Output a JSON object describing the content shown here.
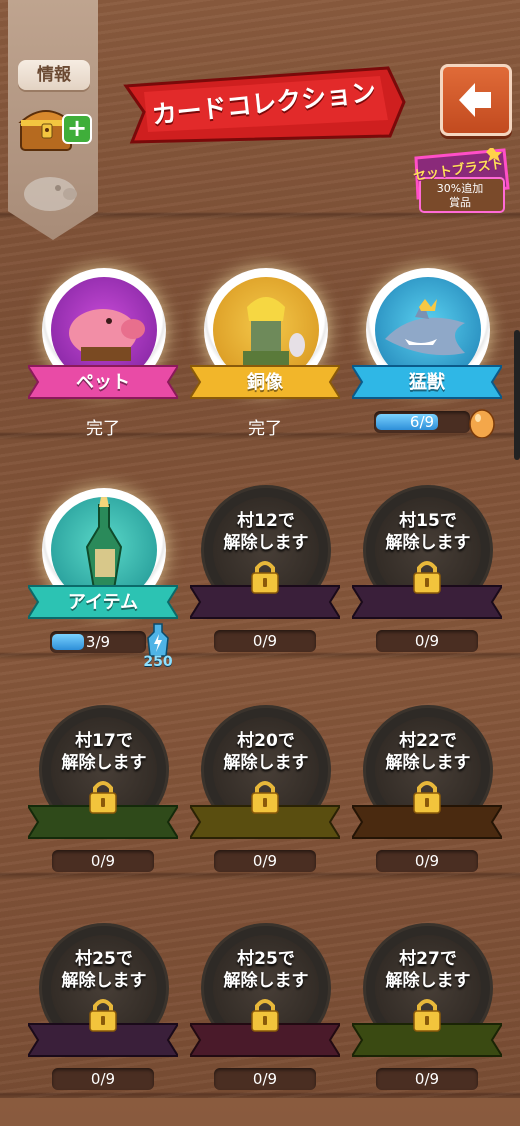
{
  "sidebar": {
    "info_label": "情報"
  },
  "header": {
    "title": "カードコレクション",
    "set_blast": {
      "title": "セットブラスト",
      "line1": "30%追加",
      "line2": "賞品"
    }
  },
  "cards": [
    {
      "banner": "ペット",
      "status": "完了",
      "banner_color": "#e94ba6"
    },
    {
      "banner": "銅像",
      "status": "完了",
      "banner_color": "#f2b62a"
    },
    {
      "banner": "猛獣",
      "banner_color": "#2fb7e6",
      "progress_text": "6/9",
      "progress": 0.67
    },
    {
      "banner": "アイテム",
      "banner_color": "#2cc3b3",
      "progress_text": "3/9",
      "progress": 0.33,
      "reward": "250"
    },
    {
      "lock_line1": "村12で",
      "lock_line2": "解除します",
      "count": "0/9",
      "banner_color": "#3a1f3a"
    },
    {
      "lock_line1": "村15で",
      "lock_line2": "解除します",
      "count": "0/9",
      "banner_color": "#3a1f3a"
    },
    {
      "lock_line1": "村17で",
      "lock_line2": "解除します",
      "count": "0/9",
      "banner_color": "#2f4a1a"
    },
    {
      "lock_line1": "村20で",
      "lock_line2": "解除します",
      "count": "0/9",
      "banner_color": "#5a4e10"
    },
    {
      "lock_line1": "村22で",
      "lock_line2": "解除します",
      "count": "0/9",
      "banner_color": "#4a2a10"
    },
    {
      "lock_line1": "村25で",
      "lock_line2": "解除します",
      "count": "0/9",
      "banner_color": "#3a1f3a"
    },
    {
      "lock_line1": "村25で",
      "lock_line2": "解除します",
      "count": "0/9",
      "banner_color": "#4a1a2a"
    },
    {
      "lock_line1": "村27で",
      "lock_line2": "解除します",
      "count": "0/9",
      "banner_color": "#3a4a12"
    }
  ]
}
